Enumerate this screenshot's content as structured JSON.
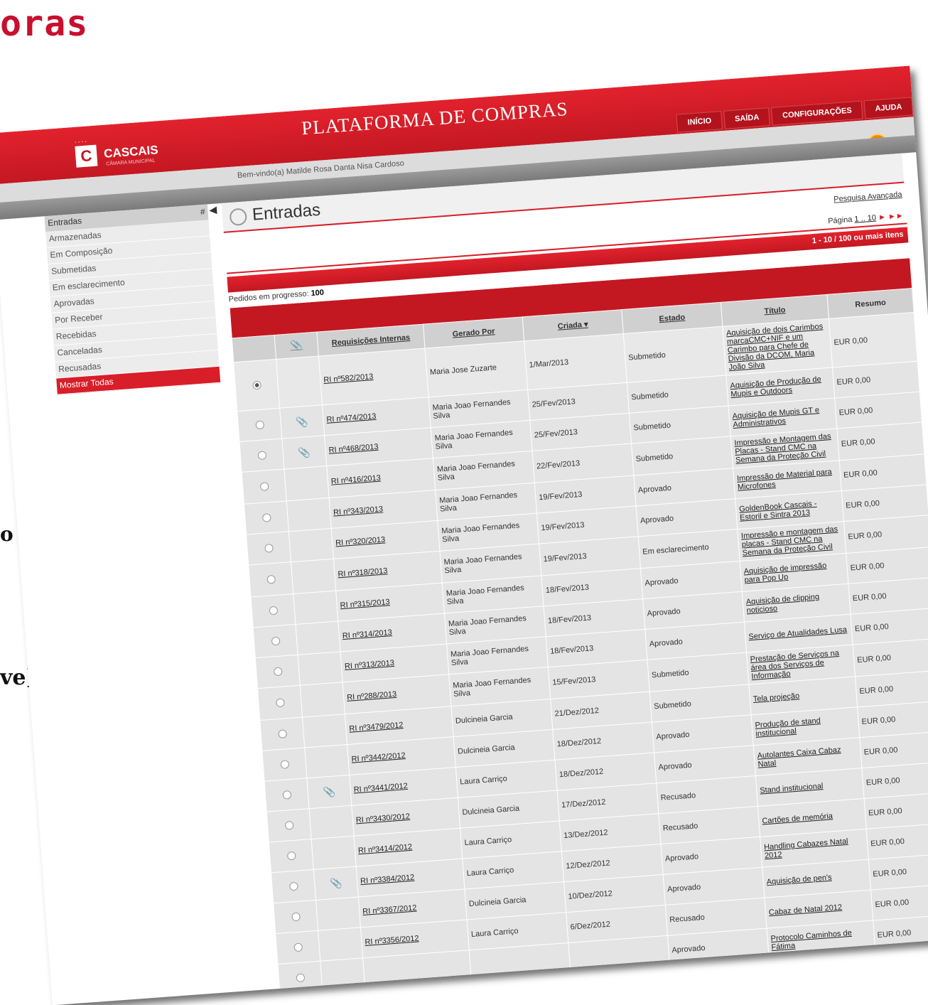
{
  "page_heading": "oras",
  "left_fragments": [
    "o",
    "ve]"
  ],
  "header": {
    "logo_dots": "....",
    "logo_letter": "C",
    "logo_text": "CASCAIS",
    "logo_sub": "CÂMARA MUNICIPAL",
    "title": "PLATAFORMA DE COMPRAS",
    "nav": [
      "INÍCIO",
      "SAÍDA",
      "CONFIGURAÇÕES",
      "AJUDA"
    ],
    "welcome": "Bem-vindo(a) Matilde Rosa Danta Nisa Cardoso",
    "info_icon": "i"
  },
  "sidebar": {
    "title": "Entradas",
    "title_suffix": "#",
    "items": [
      "Armazenadas",
      "Em Composição",
      "Submetidas",
      "Em esclarecimento",
      "Aprovadas",
      "Por Receber",
      "Recebidas",
      "Canceladas",
      "Recusadas",
      "Mostrar Todas"
    ],
    "active_item": "Mostrar Todas"
  },
  "main": {
    "title": "Entradas",
    "advanced_search": "Pesquisa Avançada",
    "pagination": {
      "label": "Página",
      "range": "1 .. 10",
      "next": "►",
      "last": "►►"
    },
    "count_text": "1 - 10 / 100 ou mais itens",
    "progress_label": "Pedidos em progresso:",
    "progress_value": "100",
    "columns": [
      "Requisições Internas",
      "Gerado Por",
      "Criada ▾",
      "Estado",
      "Título",
      "Resumo"
    ],
    "rows": [
      {
        "id": "RI nº582/2013",
        "by": "Maria Jose Zuzarte",
        "date": "1/Mar/2013",
        "state": "Submetido",
        "title": "Aquisição de dois Carimbos marcaCMC+NIF e um Carimbo para Chefe de Divisão da DCOM, Maria João Silva",
        "sum": "EUR 0,00",
        "clip": false,
        "selected": true
      },
      {
        "id": "RI nº474/2013",
        "by": "Maria Joao Fernandes Silva",
        "date": "25/Fev/2013",
        "state": "Submetido",
        "title": "Aquisição de Produção de Mupis e Outdoors",
        "sum": "EUR 0,00",
        "clip": true,
        "selected": false
      },
      {
        "id": "RI nº468/2013",
        "by": "Maria Joao Fernandes Silva",
        "date": "25/Fev/2013",
        "state": "Submetido",
        "title": "Aquisição de Mupis GT e Administrativos",
        "sum": "EUR 0,00",
        "clip": true,
        "selected": false
      },
      {
        "id": "RI nº416/2013",
        "by": "Maria Joao Fernandes Silva",
        "date": "22/Fev/2013",
        "state": "Submetido",
        "title": "Impressão e Montagem das Placas - Stand CMC na Semana da Proteção Civil",
        "sum": "EUR 0,00",
        "clip": false,
        "selected": false
      },
      {
        "id": "RI nº343/2013",
        "by": "Maria Joao Fernandes Silva",
        "date": "19/Fev/2013",
        "state": "Aprovado",
        "title": "Impressão de Material para Microfones",
        "sum": "EUR 0,00",
        "clip": false,
        "selected": false
      },
      {
        "id": "RI nº320/2013",
        "by": "Maria Joao Fernandes Silva",
        "date": "19/Fev/2013",
        "state": "Aprovado",
        "title": "GoldenBook Cascais - Estoril e Sintra 2013",
        "sum": "EUR 0,00",
        "clip": false,
        "selected": false
      },
      {
        "id": "RI nº318/2013",
        "by": "Maria Joao Fernandes Silva",
        "date": "19/Fev/2013",
        "state": "Em esclarecimento",
        "title": "Impressão e montagem das placas - Stand CMC na Semana da Proteção Civil",
        "sum": "EUR 0,00",
        "clip": false,
        "selected": false
      },
      {
        "id": "RI nº315/2013",
        "by": "Maria Joao Fernandes Silva",
        "date": "18/Fev/2013",
        "state": "Aprovado",
        "title": "Aquisição de impressão para Pop Up",
        "sum": "EUR 0,00",
        "clip": false,
        "selected": false
      },
      {
        "id": "RI nº314/2013",
        "by": "Maria Joao Fernandes Silva",
        "date": "18/Fev/2013",
        "state": "Aprovado",
        "title": "Aquisição de clipping noticioso",
        "sum": "EUR 0,00",
        "clip": false,
        "selected": false
      },
      {
        "id": "RI nº313/2013",
        "by": "Maria Joao Fernandes Silva",
        "date": "18/Fev/2013",
        "state": "Aprovado",
        "title": "Serviço de Atualidades Lusa",
        "sum": "EUR 0,00",
        "clip": false,
        "selected": false
      },
      {
        "id": "RI nº288/2013",
        "by": "Maria Joao Fernandes Silva",
        "date": "15/Fev/2013",
        "state": "Submetido",
        "title": "Prestação de Serviços na área dos Serviços de Informação",
        "sum": "EUR 0,00",
        "clip": false,
        "selected": false
      },
      {
        "id": "RI nº3479/2012",
        "by": "Dulcineia Garcia",
        "date": "21/Dez/2012",
        "state": "Submetido",
        "title": "Tela projeção",
        "sum": "EUR 0,00",
        "clip": false,
        "selected": false
      },
      {
        "id": "RI nº3442/2012",
        "by": "Dulcineia Garcia",
        "date": "18/Dez/2012",
        "state": "Aprovado",
        "title": "Produção de stand institucional",
        "sum": "EUR 0,00",
        "clip": false,
        "selected": false
      },
      {
        "id": "RI nº3441/2012",
        "by": "Laura Carriço",
        "date": "18/Dez/2012",
        "state": "Aprovado",
        "title": "Autolantes Caixa Cabaz Natal",
        "sum": "EUR 0,00",
        "clip": true,
        "selected": false
      },
      {
        "id": "RI nº3430/2012",
        "by": "Dulcineia Garcia",
        "date": "17/Dez/2012",
        "state": "Recusado",
        "title": "Stand institucional",
        "sum": "EUR 0,00",
        "clip": false,
        "selected": false
      },
      {
        "id": "RI nº3414/2012",
        "by": "Laura Carriço",
        "date": "13/Dez/2012",
        "state": "Recusado",
        "title": "Cartões de memória",
        "sum": "EUR 0,00",
        "clip": false,
        "selected": false
      },
      {
        "id": "RI nº3384/2012",
        "by": "Laura Carriço",
        "date": "12/Dez/2012",
        "state": "Aprovado",
        "title": "Handling Cabazes Natal 2012",
        "sum": "EUR 0,00",
        "clip": true,
        "selected": false
      },
      {
        "id": "RI nº3367/2012",
        "by": "Dulcineia Garcia",
        "date": "10/Dez/2012",
        "state": "Aprovado",
        "title": "Aquisição de pen's",
        "sum": "EUR 0,00",
        "clip": false,
        "selected": false
      },
      {
        "id": "RI nº3356/2012",
        "by": "Laura Carriço",
        "date": "6/Dez/2012",
        "state": "Recusado",
        "title": "Cabaz de Natal 2012",
        "sum": "EUR 0,00",
        "clip": false,
        "selected": false
      },
      {
        "id": "",
        "by": "",
        "date": "",
        "state": "Aprovado",
        "title": "Protocolo Caminhos de Fátima",
        "sum": "EUR 0,00",
        "clip": false,
        "selected": false
      }
    ]
  },
  "colors": {
    "brand_red": "#d81e29",
    "info_orange": "#f08a00"
  }
}
